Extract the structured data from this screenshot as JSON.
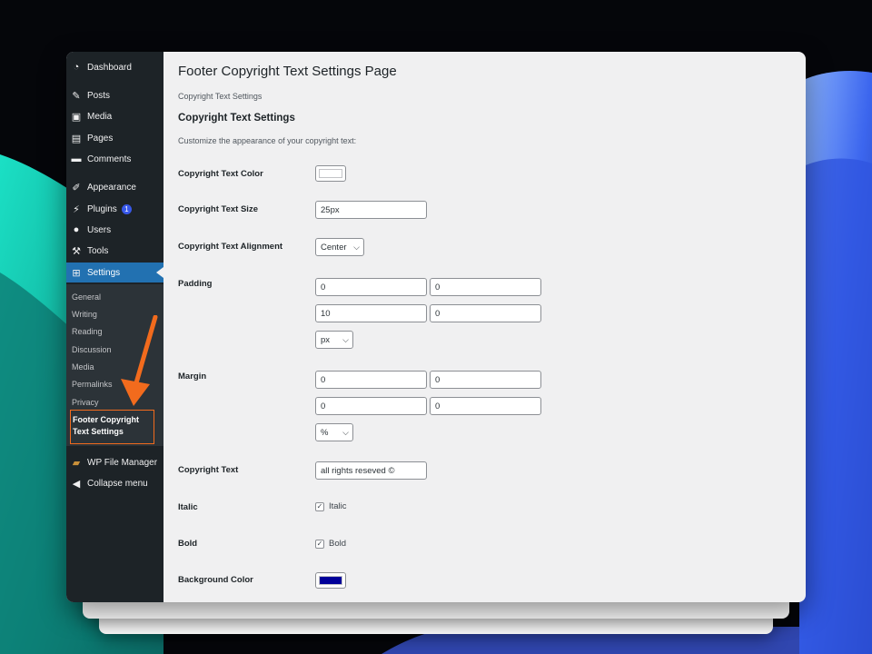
{
  "sidebar": {
    "items": [
      {
        "label": "Dashboard",
        "icon": "dashboard-icon"
      },
      {
        "label": "Posts",
        "icon": "pin-icon"
      },
      {
        "label": "Media",
        "icon": "media-icon"
      },
      {
        "label": "Pages",
        "icon": "pages-icon"
      },
      {
        "label": "Comments",
        "icon": "comment-icon"
      },
      {
        "label": "Appearance",
        "icon": "brush-icon"
      },
      {
        "label": "Plugins",
        "icon": "plugin-icon",
        "badge": "1"
      },
      {
        "label": "Users",
        "icon": "user-icon"
      },
      {
        "label": "Tools",
        "icon": "wrench-icon"
      },
      {
        "label": "Settings",
        "icon": "settings-icon"
      }
    ],
    "submenu": [
      "General",
      "Writing",
      "Reading",
      "Discussion",
      "Media",
      "Permalinks",
      "Privacy"
    ],
    "current_submenu": "Footer Copyright Text Settings",
    "extra": [
      {
        "label": "WP File Manager",
        "icon": "folder-icon"
      },
      {
        "label": "Collapse menu",
        "icon": "collapse-icon"
      }
    ]
  },
  "page": {
    "title": "Footer Copyright Text Settings Page",
    "subtitle": "Copyright Text Settings",
    "section_title": "Copyright Text Settings",
    "section_desc": "Customize the appearance of your copyright text:"
  },
  "form": {
    "color_label": "Copyright Text Color",
    "text_color": "#ffffff",
    "size_label": "Copyright Text Size",
    "size_value": "25px",
    "alignment_label": "Copyright Text Alignment",
    "alignment_value": "Center",
    "padding_label": "Padding",
    "padding_values": [
      "0",
      "0",
      "10",
      "0"
    ],
    "padding_unit": "px",
    "margin_label": "Margin",
    "margin_values": [
      "0",
      "0",
      "0",
      "0"
    ],
    "margin_unit": "%",
    "text_label": "Copyright Text",
    "text_value": "all rights reseved ©",
    "italic_label": "Italic",
    "italic_option": "Italic",
    "bold_label": "Bold",
    "bold_option": "Bold",
    "bg_label": "Background Color",
    "bg_color": "#000099"
  },
  "colors": {
    "sidebar_bg": "#1d2327",
    "active": "#2271b1",
    "highlight": "#f26b1d"
  }
}
